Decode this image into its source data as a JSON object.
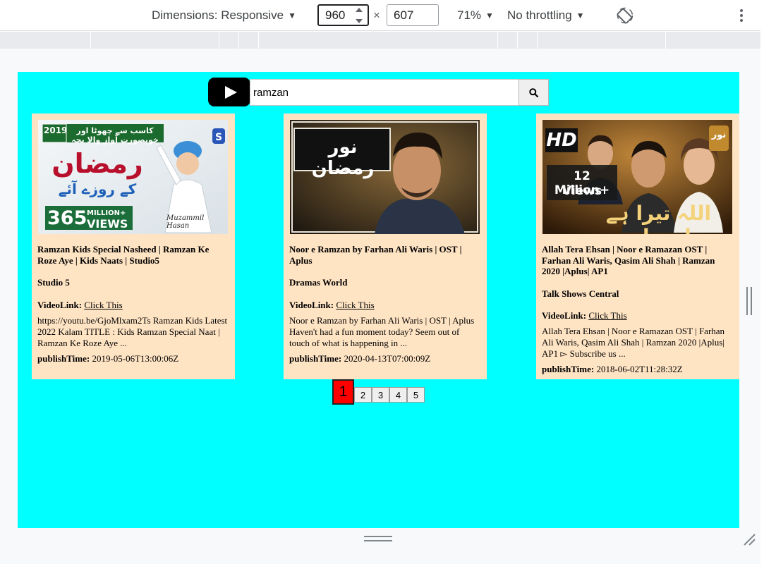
{
  "devtools": {
    "dimensions_label": "Dimensions: Responsive",
    "width_value": "960",
    "height_value": "607",
    "times": "×",
    "zoom_label": "71%",
    "throttling_label": "No throttling",
    "icons": [
      "dropdown-caret-icon",
      "rotate-icon",
      "more-vertical-icon",
      "spinner-icon"
    ]
  },
  "search": {
    "value": "ramzan",
    "logo_icon": "youtube-play-icon",
    "button_icon": "search-icon"
  },
  "videos": [
    {
      "title": "Ramzan Kids Special Nasheed | Ramzan Ke Roze Aye | Kids Naats | Studio5",
      "channel": "Studio 5",
      "video_link_label": "VideoLink:",
      "video_link_text": "Click This",
      "description": "https://youtu.be/GjoMlxam2Ts Ramzan Kids Latest 2022 Kalam TITLE : Kids Ramzan Special Naat | Ramzan Ke Roze Aye ...",
      "publish_label": "publishTime:",
      "publish_time": "2019-05-06T13:00:06Z",
      "thumb": {
        "year": "2019",
        "views_big": "365",
        "views_small": "MILLION+",
        "views_word": "VIEWS",
        "urdu_main": "رمضان",
        "urdu_sub": "کے روزے آئے",
        "urdu_banner": "کاسب سے چھوٹا اور خوبصورت آواز والا بچہ",
        "sign": "Muzammil Hasan"
      }
    },
    {
      "title": "Noor e Ramzan by Farhan Ali Waris | OST | Aplus",
      "channel": "Dramas World",
      "video_link_label": "VideoLink:",
      "video_link_text": "Click This",
      "description": "Noor e Ramzan by Farhan Ali Waris | OST | Aplus Haven't had a fun moment today? Seem out of touch of what is happening in ...",
      "publish_label": "publishTime:",
      "publish_time": "2020-04-13T07:00:09Z",
      "thumb": {
        "urdu_title": "نور رمضان"
      }
    },
    {
      "title": "Allah Tera Ehsan | Noor e Ramazan OST | Farhan Ali Waris, Qasim Ali Shah | Ramzan 2020 |Aplus| AP1",
      "channel": "Talk Shows Central",
      "video_link_label": "VideoLink:",
      "video_link_text": "Click This",
      "description": "Allah Tera Ehsan | Noor e Ramazan OST | Farhan Ali Waris, Qasim Ali Shah | Ramzan 2020 |Aplus| AP1 ▻ Subscribe us ...",
      "publish_label": "publishTime:",
      "publish_time": "2018-06-02T11:28:32Z",
      "thumb": {
        "hd": "HD",
        "views_line1": "12 Million+",
        "views_line2": "Views",
        "urdu_title": "اللہ تیرا ہے احسان",
        "logo": "نور"
      }
    }
  ],
  "pagination": {
    "pages": [
      "1",
      "2",
      "3",
      "4",
      "5"
    ],
    "current": "1"
  }
}
